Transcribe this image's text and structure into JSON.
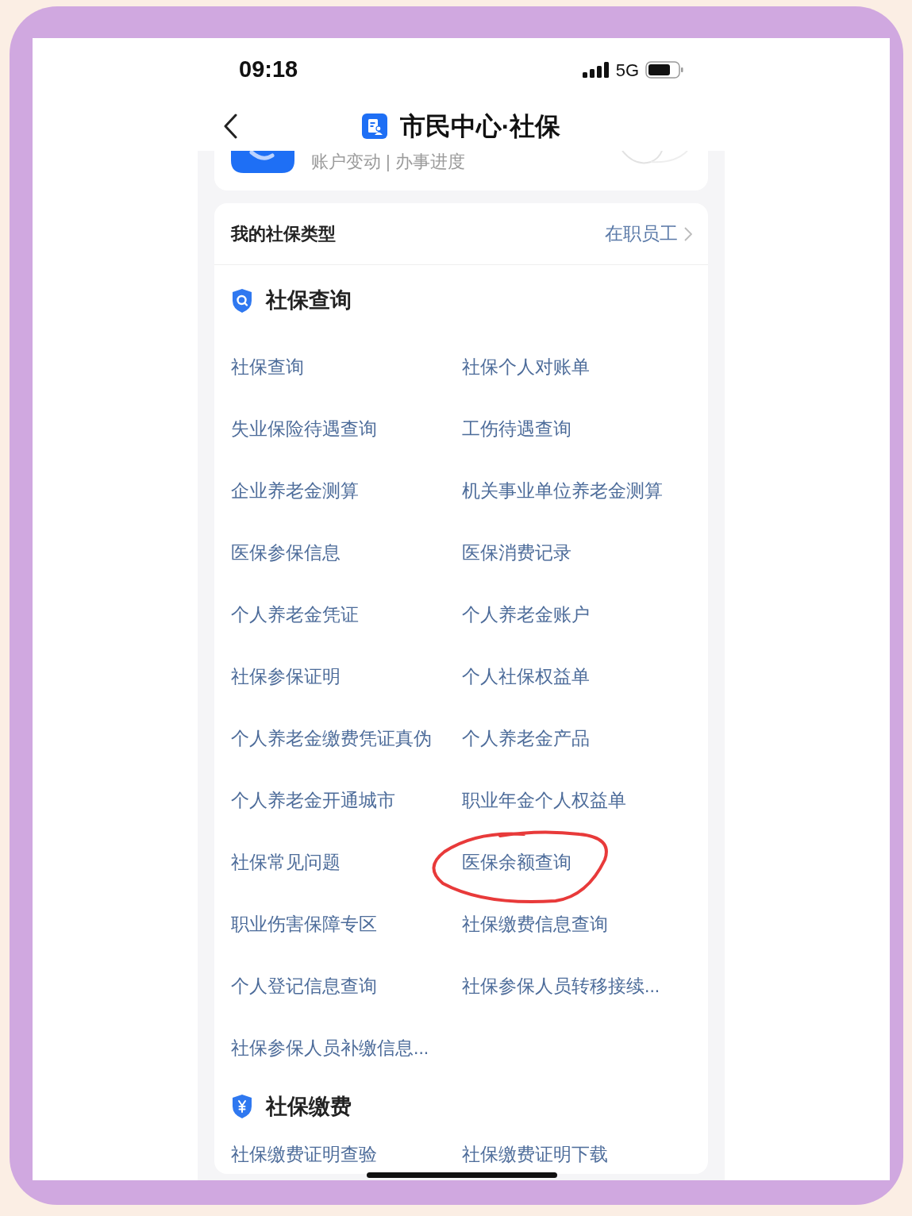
{
  "status_bar": {
    "time": "09:18",
    "network": "5G"
  },
  "nav": {
    "title": "市民中心·社保"
  },
  "top_card": {
    "subtitle": "账户变动 | 办事进度"
  },
  "insurance_type": {
    "label": "我的社保类型",
    "value": "在职员工"
  },
  "sections": [
    {
      "title": "社保查询",
      "items": [
        {
          "label": "社保查询",
          "circled": false
        },
        {
          "label": "社保个人对账单",
          "circled": false
        },
        {
          "label": "失业保险待遇查询",
          "circled": false
        },
        {
          "label": "工伤待遇查询",
          "circled": false
        },
        {
          "label": "企业养老金测算",
          "circled": false
        },
        {
          "label": "机关事业单位养老金测算",
          "circled": false
        },
        {
          "label": "医保参保信息",
          "circled": false
        },
        {
          "label": "医保消费记录",
          "circled": false
        },
        {
          "label": "个人养老金凭证",
          "circled": false
        },
        {
          "label": "个人养老金账户",
          "circled": false
        },
        {
          "label": "社保参保证明",
          "circled": false
        },
        {
          "label": "个人社保权益单",
          "circled": false
        },
        {
          "label": "个人养老金缴费凭证真伪",
          "circled": false
        },
        {
          "label": "个人养老金产品",
          "circled": false
        },
        {
          "label": "个人养老金开通城市",
          "circled": false
        },
        {
          "label": "职业年金个人权益单",
          "circled": false
        },
        {
          "label": "社保常见问题",
          "circled": false
        },
        {
          "label": "医保余额查询",
          "circled": true
        },
        {
          "label": "职业伤害保障专区",
          "circled": false
        },
        {
          "label": "社保缴费信息查询",
          "circled": false
        },
        {
          "label": "个人登记信息查询",
          "circled": false
        },
        {
          "label": "社保参保人员转移接续...",
          "circled": false
        },
        {
          "label": "社保参保人员补缴信息...",
          "circled": false
        }
      ]
    },
    {
      "title": "社保缴费",
      "items": [
        {
          "label": "社保缴费证明查验",
          "circled": false
        },
        {
          "label": "社保缴费证明下载",
          "circled": false
        }
      ]
    }
  ]
}
